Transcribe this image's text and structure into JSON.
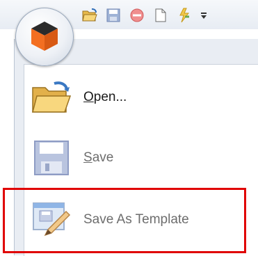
{
  "qat": {
    "icons": [
      "open-folder-icon",
      "save-icon",
      "stop-icon",
      "new-document-icon",
      "lightning-icon",
      "dropdown-arrow-icon"
    ]
  },
  "app_button": {
    "icon": "cube-logo-icon"
  },
  "menu": {
    "items": [
      {
        "name": "open",
        "label_prefix": "O",
        "label_rest": "pen...",
        "icon": "open-folder-icon",
        "enabled": true
      },
      {
        "name": "save",
        "label_prefix": "S",
        "label_rest": "ave",
        "icon": "save-icon",
        "enabled": false
      },
      {
        "name": "save-as-template",
        "label": "Save As Template",
        "icon": "save-as-template-icon",
        "enabled": false
      }
    ]
  },
  "colors": {
    "highlight": "#e00000",
    "disabled_text": "#6d6d6d",
    "menu_bg": "#e9edf3"
  }
}
